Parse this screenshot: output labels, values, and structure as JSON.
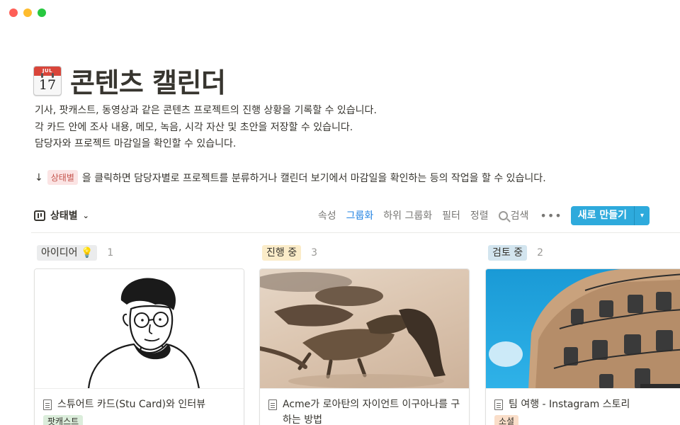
{
  "window": {
    "controls": [
      "close",
      "minimize",
      "zoom"
    ]
  },
  "page": {
    "icon": "calendar-icon",
    "calendar_month": "JUL",
    "calendar_day": "17",
    "title": "콘텐츠 캘린더",
    "description": [
      "기사, 팟캐스트, 동영상과 같은 콘텐츠 프로젝트의 진행 상황을 기록할 수 있습니다.",
      "각 카드 안에 조사 내용, 메모, 녹음, 시각 자산 및 초안을 저장할 수 있습니다.",
      "담당자와 프로젝트 마감일을 확인할 수 있습니다."
    ],
    "hint": {
      "arrow": "↓",
      "pill": "상태별",
      "text": "을 클릭하면 담당자별로 프로젝트를 분류하거나 캘린더 보기에서 마감일을 확인하는 등의 작업을 할 수 있습니다."
    }
  },
  "toolbar": {
    "view_label": "상태별",
    "view_chevron": "⌄",
    "properties": "속성",
    "group": "그룹화",
    "subgroup": "하위 그룹화",
    "filter": "필터",
    "sort": "정렬",
    "search": "검색",
    "more": "•••",
    "new_button": "새로 만들기",
    "new_dropdown": "▾"
  },
  "columns": [
    {
      "label": "아이디어 💡",
      "count": "1",
      "color": "#ebeced"
    },
    {
      "label": "진행 중",
      "count": "3",
      "color": "#fbecc9"
    },
    {
      "label": "검토 중",
      "count": "2",
      "color": "#d3e5ef"
    }
  ],
  "cards": [
    {
      "title": "스튜어트 카드(Stu Card)와 인터뷰",
      "property": "팟캐스트",
      "image": "illustrated-portrait"
    },
    {
      "title": "Acme가 로아탄의 자이언트 이구아나를 구하는 방법",
      "property": "",
      "image": "iguanas-photo"
    },
    {
      "title": "팀 여행 - Instagram 스토리",
      "property": "소셜",
      "image": "building-photo"
    }
  ]
}
